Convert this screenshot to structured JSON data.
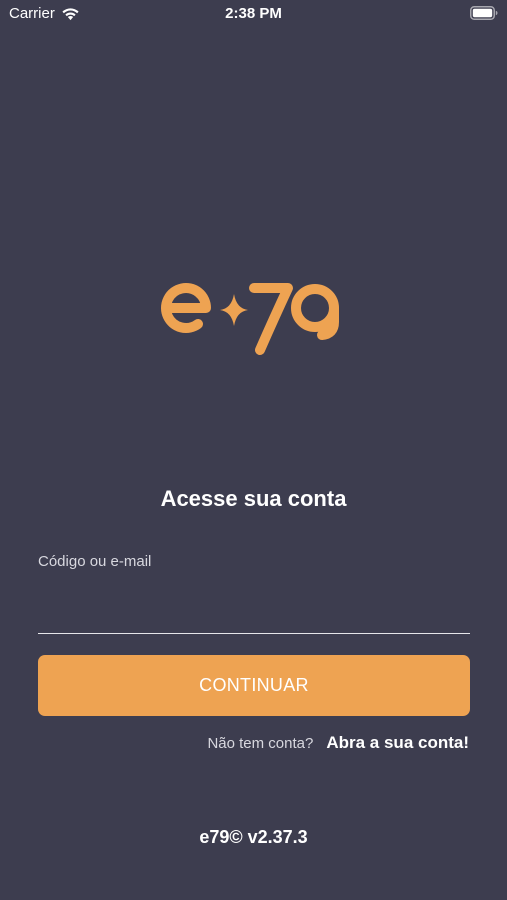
{
  "status_bar": {
    "carrier": "Carrier",
    "time": "2:38 PM",
    "wifi_icon": "wifi-icon",
    "battery_icon": "battery-icon"
  },
  "brand": {
    "logo_text": "e79",
    "accent_color": "#eea352",
    "background_color": "#3d3d4f"
  },
  "login": {
    "title": "Acesse sua conta",
    "field_label": "Código ou e-mail",
    "field_value": "",
    "continue_label": "CONTINUAR",
    "signup_question": "Não tem conta?",
    "signup_link": "Abra a sua conta!"
  },
  "footer": {
    "version": "e79© v2.37.3"
  }
}
